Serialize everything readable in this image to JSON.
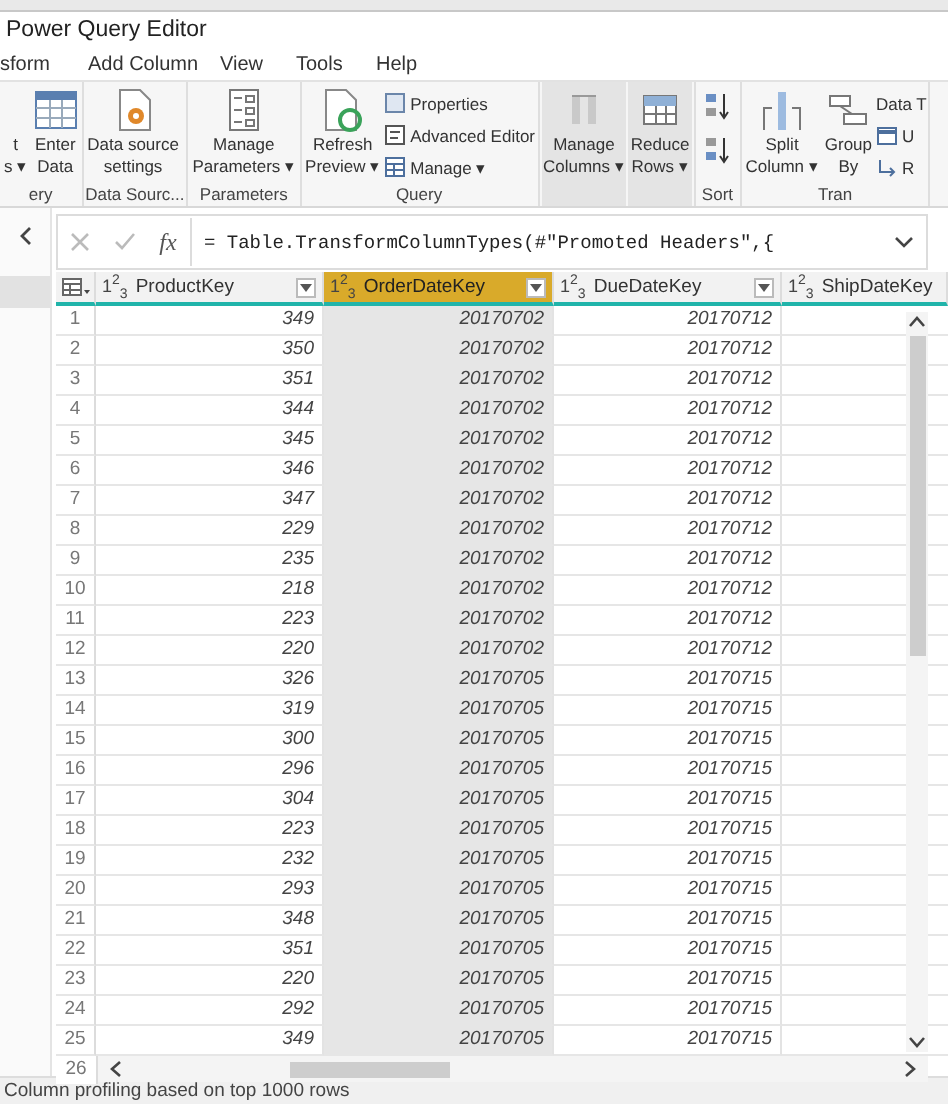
{
  "window": {
    "title": "Power Query Editor"
  },
  "menu": [
    "sform",
    "Add Column",
    "View",
    "Tools",
    "Help"
  ],
  "ribbon": {
    "groups": [
      {
        "label": "ery",
        "items": [
          {
            "kind": "large",
            "lines": [
              "t",
              "s ▾"
            ]
          },
          {
            "kind": "large",
            "lines": [
              "Enter",
              "Data"
            ]
          }
        ]
      },
      {
        "label": "Data Sourc...",
        "items": [
          {
            "kind": "large",
            "lines": [
              "Data source",
              "settings"
            ]
          }
        ]
      },
      {
        "label": "Parameters",
        "items": [
          {
            "kind": "large",
            "lines": [
              "Manage",
              "Parameters ▾"
            ]
          }
        ]
      },
      {
        "label": "Query",
        "items": [
          {
            "kind": "large",
            "lines": [
              "Refresh",
              "Preview ▾"
            ]
          },
          {
            "kind": "stack",
            "entries": [
              "Properties",
              "Advanced Editor",
              "Manage ▾"
            ]
          }
        ]
      },
      {
        "items": [
          {
            "kind": "framed",
            "lines": [
              "Manage",
              "Columns ▾"
            ]
          },
          {
            "kind": "framed",
            "lines": [
              "Reduce",
              "Rows ▾"
            ]
          }
        ]
      },
      {
        "label": "Sort",
        "items": [
          {
            "kind": "sort"
          }
        ]
      },
      {
        "label": "Tran",
        "items": [
          {
            "kind": "large",
            "lines": [
              "Split",
              "Column ▾"
            ]
          },
          {
            "kind": "large",
            "lines": [
              "Group",
              "By"
            ]
          },
          {
            "kind": "stack",
            "entries": [
              "Data T",
              "U",
              "R"
            ]
          }
        ]
      }
    ]
  },
  "formula": {
    "fx": "fx",
    "value": "= Table.TransformColumnTypes(#\"Promoted Headers\",{"
  },
  "table": {
    "columns": [
      {
        "name": "ProductKey",
        "type": "1$^{2}$$_{3}$",
        "selected": false,
        "filter": true
      },
      {
        "name": "OrderDateKey",
        "type": "1$^{2}$$_{3}$",
        "selected": true,
        "filter": true
      },
      {
        "name": "DueDateKey",
        "type": "1$^{2}$$_{3}$",
        "selected": false,
        "filter": true
      },
      {
        "name": "ShipDateKey",
        "type": "1$^{2}$$_{3}$",
        "selected": false,
        "filter": false
      }
    ],
    "rows": [
      [
        "1",
        "349",
        "20170702",
        "20170712"
      ],
      [
        "2",
        "350",
        "20170702",
        "20170712"
      ],
      [
        "3",
        "351",
        "20170702",
        "20170712"
      ],
      [
        "4",
        "344",
        "20170702",
        "20170712"
      ],
      [
        "5",
        "345",
        "20170702",
        "20170712"
      ],
      [
        "6",
        "346",
        "20170702",
        "20170712"
      ],
      [
        "7",
        "347",
        "20170702",
        "20170712"
      ],
      [
        "8",
        "229",
        "20170702",
        "20170712"
      ],
      [
        "9",
        "235",
        "20170702",
        "20170712"
      ],
      [
        "10",
        "218",
        "20170702",
        "20170712"
      ],
      [
        "11",
        "223",
        "20170702",
        "20170712"
      ],
      [
        "12",
        "220",
        "20170702",
        "20170712"
      ],
      [
        "13",
        "326",
        "20170705",
        "20170715"
      ],
      [
        "14",
        "319",
        "20170705",
        "20170715"
      ],
      [
        "15",
        "300",
        "20170705",
        "20170715"
      ],
      [
        "16",
        "296",
        "20170705",
        "20170715"
      ],
      [
        "17",
        "304",
        "20170705",
        "20170715"
      ],
      [
        "18",
        "223",
        "20170705",
        "20170715"
      ],
      [
        "19",
        "232",
        "20170705",
        "20170715"
      ],
      [
        "20",
        "293",
        "20170705",
        "20170715"
      ],
      [
        "21",
        "348",
        "20170705",
        "20170715"
      ],
      [
        "22",
        "351",
        "20170705",
        "20170715"
      ],
      [
        "23",
        "220",
        "20170705",
        "20170715"
      ],
      [
        "24",
        "292",
        "20170705",
        "20170715"
      ],
      [
        "25",
        "349",
        "20170705",
        "20170715"
      ]
    ],
    "partial_row": "26"
  },
  "status_bar": "Column profiling based on top 1000 rows"
}
